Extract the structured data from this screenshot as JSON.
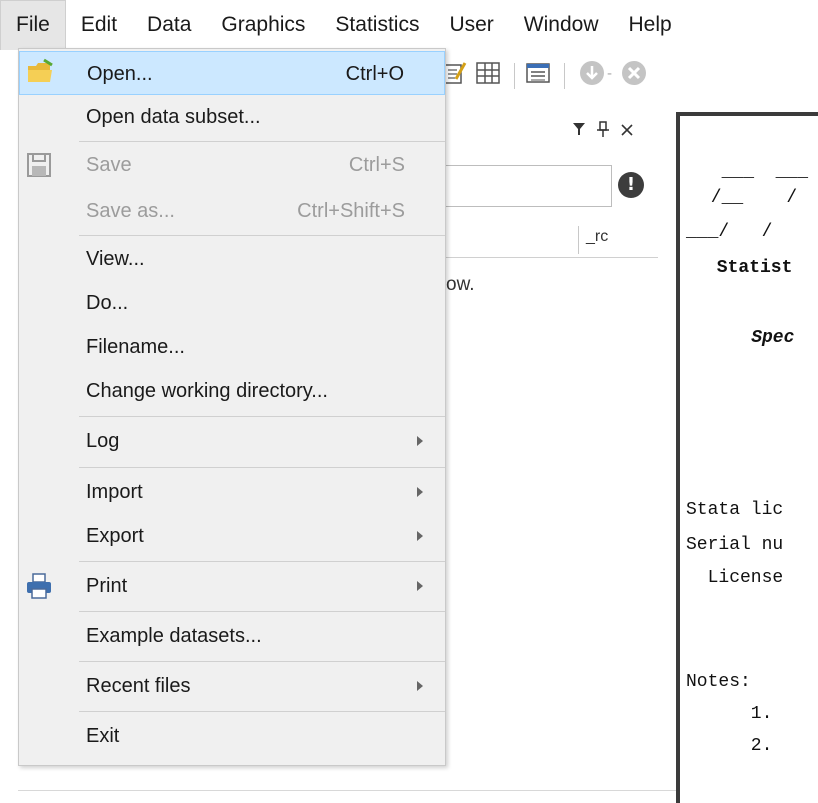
{
  "menubar": {
    "items": [
      "File",
      "Edit",
      "Data",
      "Graphics",
      "Statistics",
      "User",
      "Window",
      "Help"
    ]
  },
  "variables_panel": {
    "column_rc": "_rc",
    "partial_text": "ow."
  },
  "results": {
    "lines": [
      "  ___  ___",
      " /__    /",
      "___/   /",
      " Statist",
      "    Spec",
      "Stata lic",
      "Serial nu",
      "  License",
      "Notes:",
      "      1.",
      "      2."
    ]
  },
  "file_menu": {
    "items": [
      {
        "label": "Open...",
        "shortcut": "Ctrl+O",
        "icon": "folder-open-icon",
        "highlighted": true
      },
      {
        "label": "Open data subset..."
      },
      {
        "label": "Save",
        "shortcut": "Ctrl+S",
        "icon": "floppy-disk-icon",
        "disabled": true
      },
      {
        "label": "Save as...",
        "shortcut": "Ctrl+Shift+S",
        "disabled": true
      },
      {
        "label": "View..."
      },
      {
        "label": "Do..."
      },
      {
        "label": "Filename..."
      },
      {
        "label": "Change working directory..."
      },
      {
        "label": "Log",
        "submenu": true
      },
      {
        "label": "Import",
        "submenu": true
      },
      {
        "label": "Export",
        "submenu": true
      },
      {
        "label": "Print",
        "submenu": true,
        "icon": "printer-icon"
      },
      {
        "label": "Example datasets..."
      },
      {
        "label": "Recent files",
        "submenu": true
      },
      {
        "label": "Exit"
      }
    ]
  },
  "colors": {
    "highlight": "#cce8ff",
    "menu_bg": "#f0f0f0",
    "disabled_text": "#9c9c9c"
  }
}
